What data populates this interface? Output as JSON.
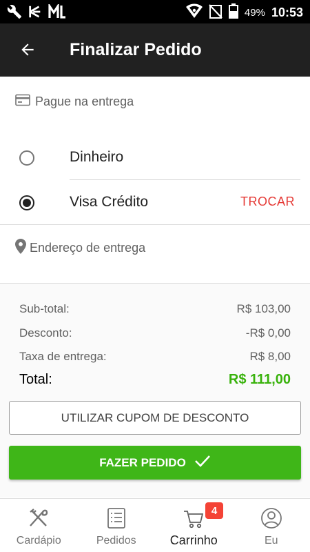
{
  "status_bar": {
    "icons_left": [
      "wrench-icon",
      "tasks-app-icon",
      "ml-app-icon"
    ],
    "icons_right": [
      "wifi-icon",
      "no-signal-icon",
      "battery-icon"
    ],
    "battery_percent": "49%",
    "time": "10:53"
  },
  "app_bar": {
    "back_icon": "arrow-back-icon",
    "title": "Finalizar Pedido"
  },
  "payment": {
    "header_icon": "credit-card-icon",
    "header": "Pague na entrega",
    "options": [
      {
        "label": "Dinheiro",
        "selected": false
      },
      {
        "label": "Visa Crédito",
        "selected": true
      }
    ],
    "change_label": "TROCAR"
  },
  "address": {
    "header_icon": "location-pin-icon",
    "header": "Endereço de entrega"
  },
  "summary": {
    "subtotal_label": "Sub-total:",
    "subtotal_value": "R$ 103,00",
    "discount_label": "Desconto:",
    "discount_value": "-R$ 0,00",
    "delivery_label": "Taxa de entrega:",
    "delivery_value": "R$ 8,00",
    "total_label": "Total:",
    "total_value": "R$ 111,00"
  },
  "buttons": {
    "coupon": "UTILIZAR CUPOM DE DESCONTO",
    "order": "FAZER PEDIDO"
  },
  "colors": {
    "accent_green": "#3fb618",
    "total_green": "#38b20b",
    "trocar_red": "#e53935",
    "app_bar": "#212121",
    "badge_red": "#f44336"
  },
  "bottom_nav": {
    "items": [
      {
        "label": "Cardápio",
        "icon": "fork-knife-icon"
      },
      {
        "label": "Pedidos",
        "icon": "list-icon"
      },
      {
        "label": "Carrinho",
        "icon": "cart-icon"
      },
      {
        "label": "Eu",
        "icon": "user-icon"
      }
    ],
    "active_index": 2,
    "cart_badge": "4"
  }
}
